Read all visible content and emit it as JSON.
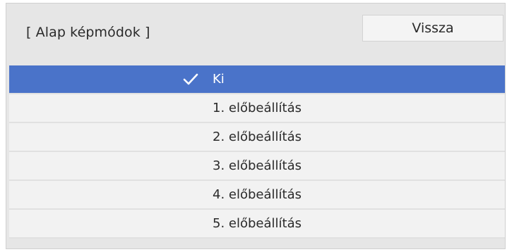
{
  "header": {
    "title": "[ Alap képmódok ]",
    "back_label": "Vissza"
  },
  "menu": {
    "selected_index": 0,
    "items": [
      {
        "label": "Ki",
        "selected": true,
        "icon": "checkmark-icon"
      },
      {
        "label": "1. előbeállítás",
        "selected": false
      },
      {
        "label": "2. előbeállítás",
        "selected": false
      },
      {
        "label": "3. előbeállítás",
        "selected": false
      },
      {
        "label": "4. előbeállítás",
        "selected": false
      },
      {
        "label": "5. előbeállítás",
        "selected": false
      }
    ]
  },
  "colors": {
    "selected_row": "#4a73c9",
    "row_background": "#f2f2f2",
    "panel_background": "#e6e6e6"
  }
}
